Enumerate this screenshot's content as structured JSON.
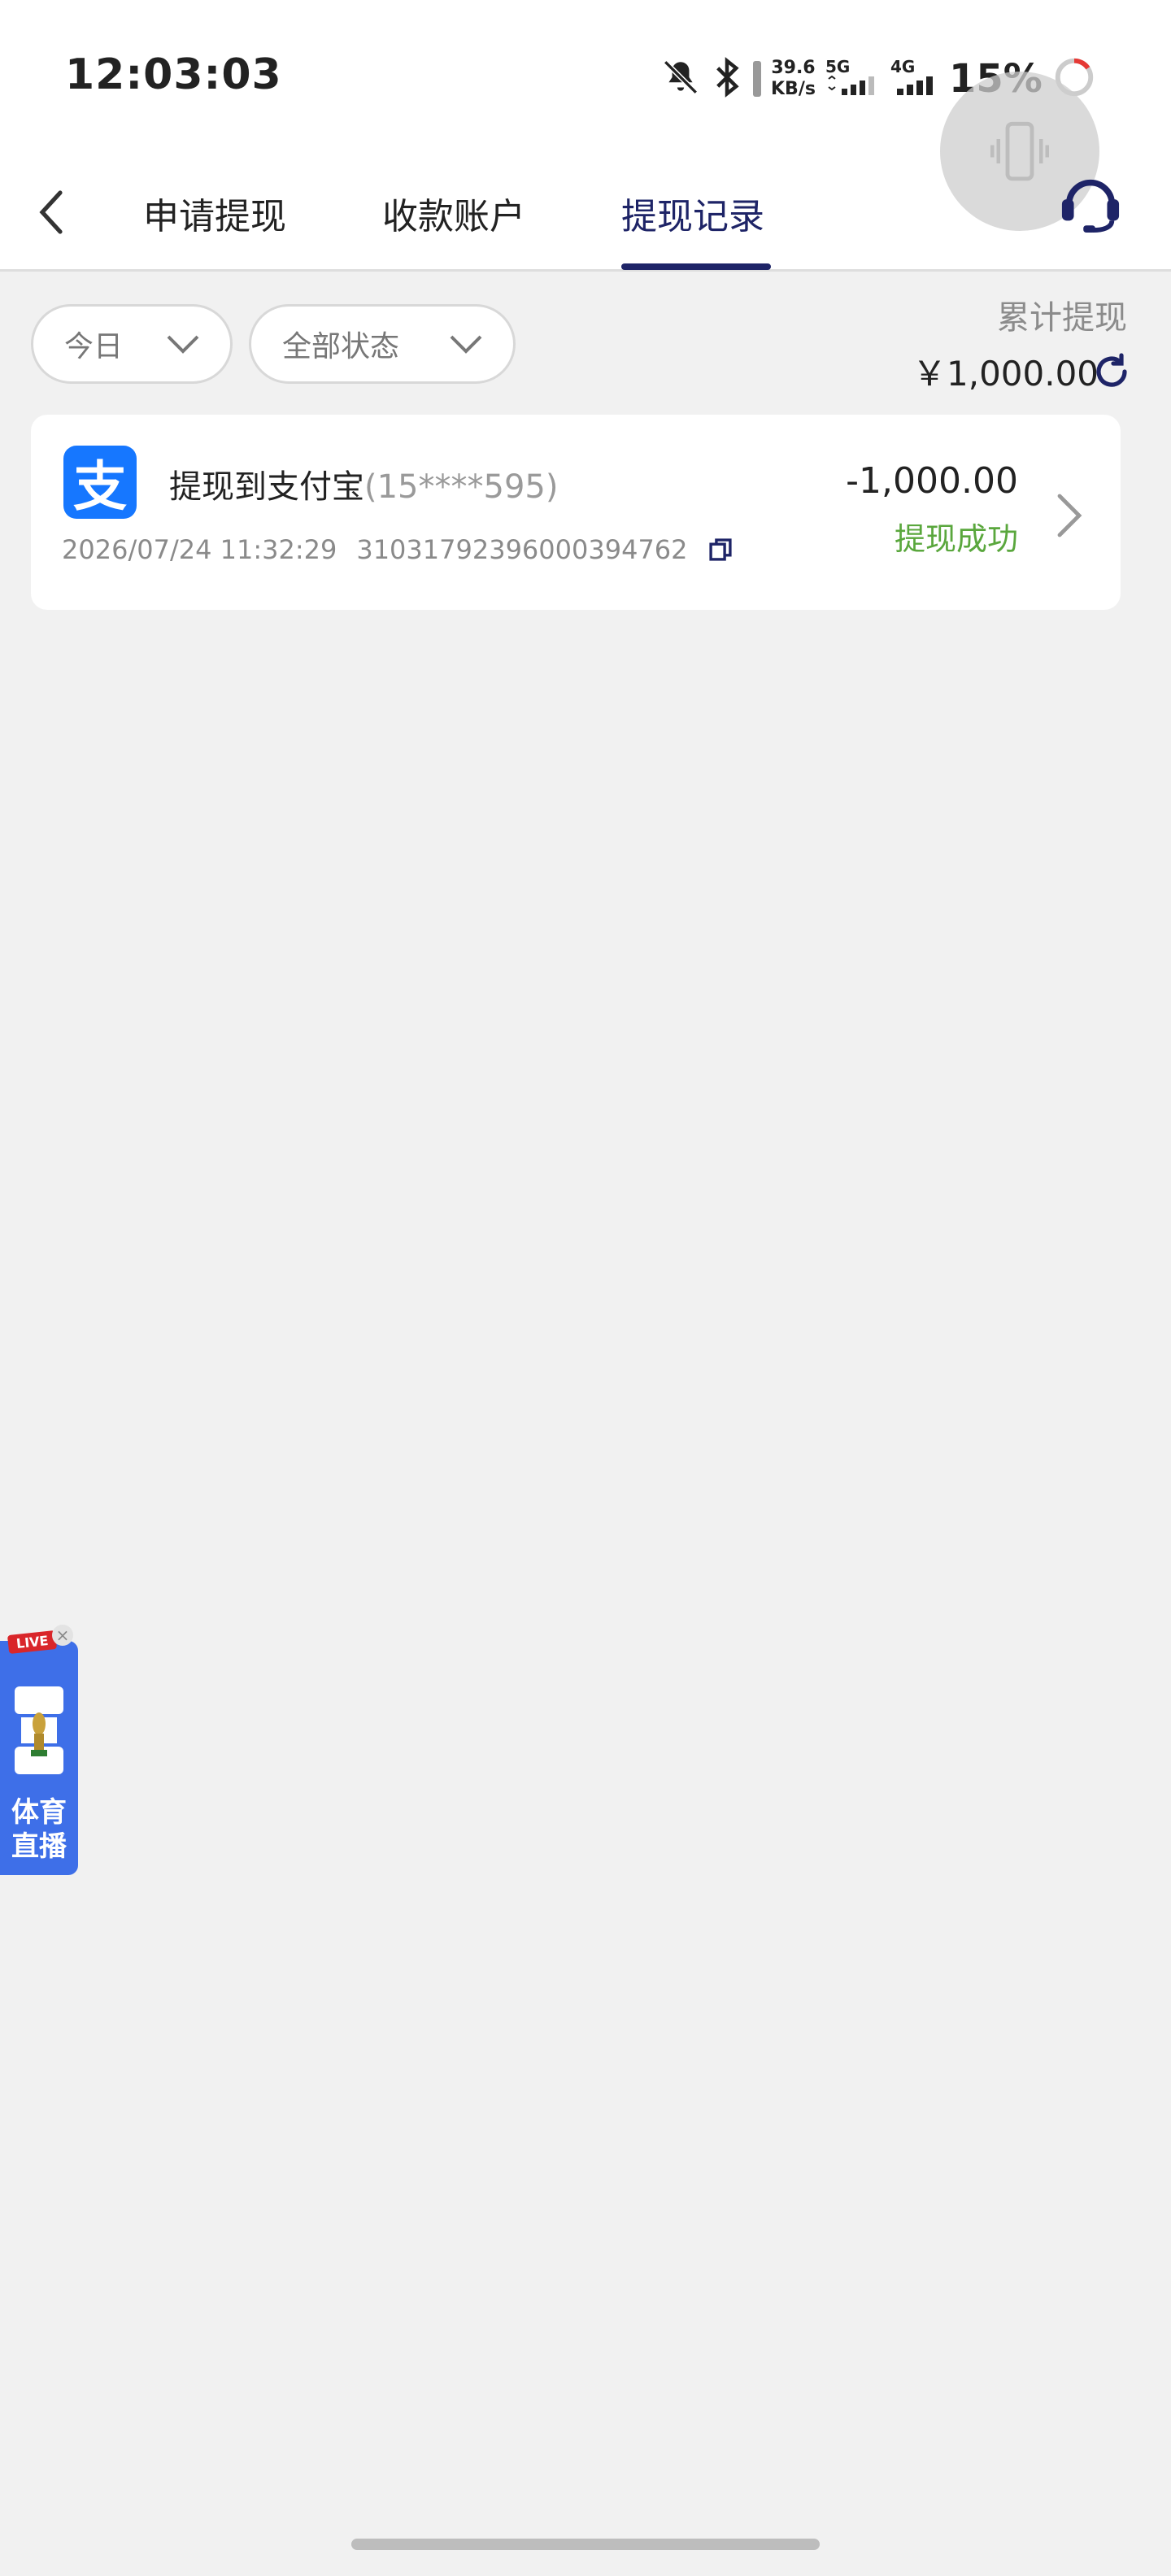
{
  "status_bar": {
    "time": "12:03:03",
    "speed_value": "39.6",
    "speed_unit": "KB/s",
    "net1": "5G",
    "net2": "4G",
    "battery": "15%",
    "icons": [
      "bell-off-icon",
      "bluetooth-icon",
      "signal-icon",
      "battery-ring-icon"
    ]
  },
  "header": {
    "tabs": [
      {
        "label": "申请提现",
        "active": false
      },
      {
        "label": "收款账户",
        "active": false
      },
      {
        "label": "提现记录",
        "active": true
      }
    ],
    "accent_color": "#1e2467"
  },
  "filters": {
    "date": "今日",
    "status": "全部状态"
  },
  "summary": {
    "label": "累计提现",
    "amount": "￥1,000.00"
  },
  "records": [
    {
      "title": "提现到支付宝",
      "account": "(15****595)",
      "datetime": "2026/07/24 11:32:29",
      "serial": "31031792396000394762",
      "amount": "-1,000.00",
      "status": "提现成功",
      "status_color": "#5aa73d",
      "logo_char": "支"
    }
  ],
  "live_badge": {
    "tag": "LIVE",
    "line1": "体育",
    "line2": "直播"
  }
}
